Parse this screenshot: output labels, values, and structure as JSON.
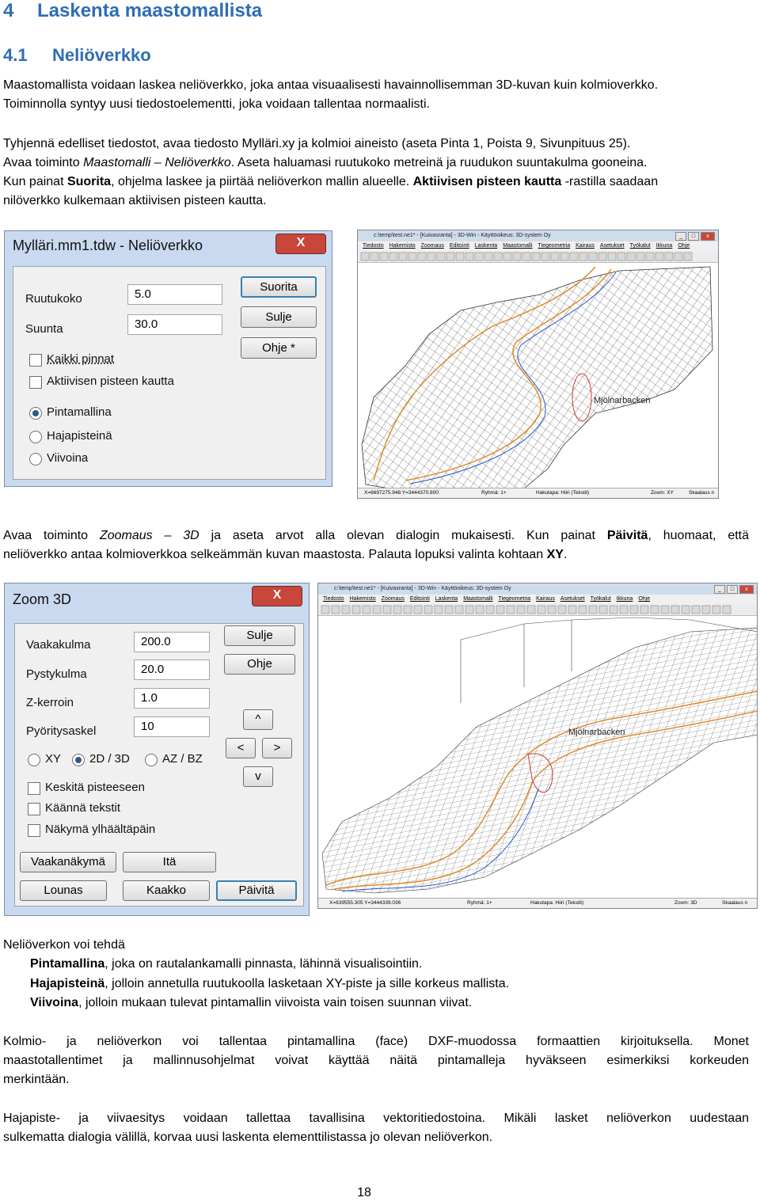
{
  "heading1": {
    "num": "4",
    "text": "Laskenta maastomallista"
  },
  "heading2": {
    "num": "4.1",
    "text": "Neliöverkko"
  },
  "intro": {
    "line1": "Maastomallista voidaan laskea neliöverkko, joka antaa visuaalisesti havainnollisemman 3D-kuvan kuin kolmioverkko.",
    "line2": "Toiminnolla syntyy uusi tiedostoelementti, joka voidaan tallentaa normaalisti."
  },
  "para2": {
    "line1": "Tyhjennä edelliset tiedostot, avaa tiedosto Mylläri.xy ja kolmioi aineisto (aseta Pinta 1, Poista 9, Sivunpituus 25).",
    "line2_pre": "Avaa toiminto ",
    "line2_italic": "Maastomalli – Neliöverkko",
    "line2_post": ". Aseta haluamasi ruutukoko metreinä ja ruudukon suuntakulma gooneina.",
    "line3_pre": "Kun painat ",
    "line3_bold": "Suorita",
    "line3_mid": ", ohjelma laskee ja piirtää neliöverkon mallin alueelle. ",
    "line3_bold2": "Aktiivisen pisteen kautta",
    "line3_post": " -rastilla saadaan",
    "line4": "nilöverkko kulkemaan aktiivisen pisteen kautta."
  },
  "dialog1": {
    "title": "Mylläri.mm1.tdw - Neliöverkko",
    "close": "X",
    "ruutukoko_label": "Ruutukoko",
    "ruutukoko_value": "5.0",
    "suunta_label": "Suunta",
    "suunta_value": "30.0",
    "btn_suorita": "Suorita",
    "btn_sulje": "Sulje",
    "btn_ohje": "Ohje *",
    "chk_kaikki": "Kaikki pinnat",
    "chk_aktiivisen": "Aktiivisen pisteen kautta",
    "rad_pinta": "Pintamallina",
    "rad_haja": "Hajapisteinä",
    "rad_viivo": "Viivoina"
  },
  "app1": {
    "title": "c:\\temp\\test.ne1* - [Kuivasranta] - 3D-Win - Käyttöoikeus: 3D-system Oy",
    "menu": [
      "Tiedosto",
      "Hakemisto",
      "Zoomaus",
      "Editointi",
      "Laskenta",
      "Maastomalli",
      "Tiegeometria",
      "Kairaus",
      "Asetukset",
      "Työkalut",
      "Ikkuna",
      "Ohje"
    ],
    "place_label": "Mjölnarbacken",
    "status": {
      "coords": "X=6697275.948  Y=3444370.800",
      "group": "Ryhmä: 1+",
      "snap": "Hakutapa: Hiiri (Tekstit)",
      "zoom": "Zoom: XY",
      "scale": "Skaalaus n"
    }
  },
  "para3": {
    "pre": "Avaa toiminto ",
    "italic": "Zoomaus – 3D",
    "mid": " ja aseta arvot alla olevan dialogin mukaisesti. Kun painat ",
    "bold": "Päivitä",
    "post": ", huomaat, että",
    "line2_pre": "neliöverkko antaa kolmioverkkoa selkeämmän kuvan maastosta. Palauta lopuksi valinta kohtaan ",
    "line2_bold": "XY",
    "line2_post": "."
  },
  "dialog2": {
    "title": "Zoom 3D",
    "close": "X",
    "vaakakulma_label": "Vaakakulma",
    "vaakakulma_value": "200.0",
    "pystykulma_label": "Pystykulma",
    "pystykulma_value": "20.0",
    "zkerroin_label": "Z-kerroin",
    "zkerroin_value": "1.0",
    "pyoritys_label": "Pyöritysaskel",
    "pyoritys_value": "10",
    "btn_sulje": "Sulje",
    "btn_ohje": "Ohje",
    "btn_up": "^",
    "btn_left": "<",
    "btn_right": ">",
    "btn_down": "v",
    "rad_xy": "XY",
    "rad_2d3d": "2D / 3D",
    "rad_azbz": "AZ / BZ",
    "chk_keskita": "Keskitä pisteeseen",
    "chk_kaanna": "Käännä tekstit",
    "chk_nakyma": "Näkymä ylhäältäpäin",
    "btn_vaaka": "Vaakanäkymä",
    "btn_ita": "Itä",
    "btn_lounas": "Lounas",
    "btn_kaakko": "Kaakko",
    "btn_paivita": "Päivitä"
  },
  "app2": {
    "title": "c:\\temp\\test.ne1* - [Kuivasranta] - 3D-Win - Käyttöoikeus: 3D-system Oy",
    "menu": [
      "Tiedosto",
      "Hakemisto",
      "Zoomaus",
      "Editointi",
      "Laskenta",
      "Maastomalli",
      "Tiegeometria",
      "Kairaus",
      "Asetukset",
      "Työkalut",
      "Ikkuna",
      "Ohje"
    ],
    "place_label": "Mjölnarbacken",
    "status": {
      "coords": "X=639555.305  Y=3444339.036",
      "group": "Ryhmä: 1+",
      "snap": "Hakutapa: Hiiri (Tekstit)",
      "zoom": "Zoom: 3D",
      "scale": "Skaalaus n"
    }
  },
  "list": {
    "intro": "Neliöverkon voi tehdä",
    "item1_bold": "Pintamallina",
    "item1": ", joka on rautalankamalli pinnasta, lähinnä visualisointiin.",
    "item2_bold": "Hajapisteinä",
    "item2": ", jolloin annetulla ruutukoolla lasketaan XY-piste ja sille korkeus mallista.",
    "item3_bold": "Viivoina",
    "item3": ", jolloin mukaan tulevat pintamallin viivoista vain toisen suunnan viivat."
  },
  "para5": {
    "line1": "Kolmio- ja neliöverkon voi tallentaa pintamallina (face) DXF-muodossa formaattien kirjoituksella. Monet",
    "line2": "maastotallentimet ja mallinnusohjelmat voivat käyttää näitä pintamalleja hyväkseen esimerkiksi korkeuden",
    "line3": "merkintään."
  },
  "para6": {
    "line1": "Hajapiste- ja viivaesitys voidaan tallettaa tavallisina vektoritiedostoina. Mikäli lasket neliöverkon uudestaan",
    "line2": "sulkematta dialogia välillä, korvaa uusi laskenta elementtilistassa jo olevan neliöverkon."
  },
  "page_number": "18"
}
